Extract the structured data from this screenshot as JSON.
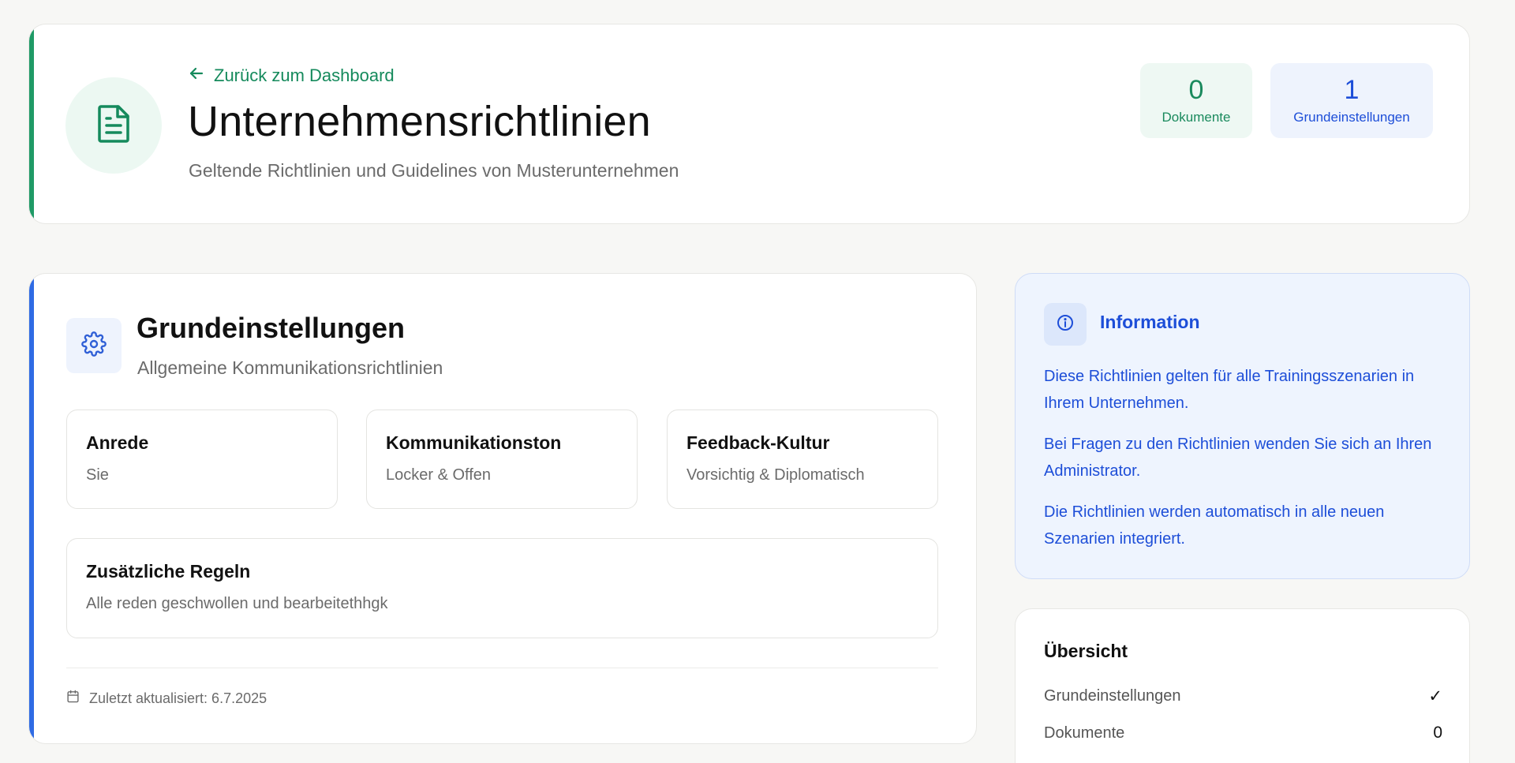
{
  "header": {
    "back_link": "Zurück zum Dashboard",
    "title": "Unternehmensrichtlinien",
    "subtitle": "Geltende Richtlinien und Guidelines von Musterunternehmen",
    "icon": "document-icon",
    "stats": {
      "documents": {
        "value": "0",
        "label": "Dokumente"
      },
      "basic_settings": {
        "value": "1",
        "label": "Grundeinstellungen"
      }
    }
  },
  "settings": {
    "icon": "gear-icon",
    "title": "Grundeinstellungen",
    "subtitle": "Allgemeine Kommunikationsrichtlinien",
    "tiles": [
      {
        "label": "Anrede",
        "value": "Sie"
      },
      {
        "label": "Kommunikationston",
        "value": "Locker & Offen"
      },
      {
        "label": "Feedback-Kultur",
        "value": "Vorsichtig & Diplomatisch"
      }
    ],
    "additional_rules": {
      "label": "Zusätzliche Regeln",
      "value": "Alle reden geschwollen und bearbeitethhgk"
    },
    "last_updated": "Zuletzt aktualisiert: 6.7.2025"
  },
  "info": {
    "icon": "info-icon",
    "title": "Information",
    "paragraphs": [
      "Diese Richtlinien gelten für alle Trainingsszenarien in Ihrem Unternehmen.",
      "Bei Fragen zu den Richtlinien wenden Sie sich an Ihren Administrator.",
      "Die Richtlinien werden automatisch in alle neuen Szenarien integriert."
    ]
  },
  "overview": {
    "title": "Übersicht",
    "rows": [
      {
        "label": "Grundeinstellungen",
        "value": "✓"
      },
      {
        "label": "Dokumente",
        "value": "0"
      }
    ]
  },
  "colors": {
    "green_accent": "#1f9a66",
    "blue_accent": "#2f6be4",
    "info_text": "#1d4ed8"
  }
}
